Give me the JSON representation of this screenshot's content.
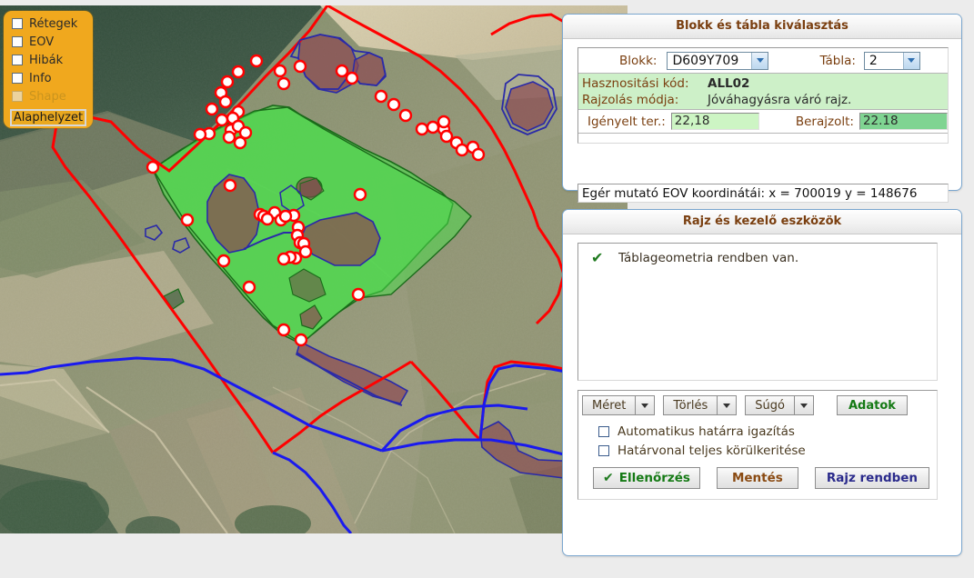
{
  "layers_panel": {
    "items": [
      {
        "label": "Rétegek",
        "checked": false,
        "enabled": true
      },
      {
        "label": "EOV",
        "checked": false,
        "enabled": true
      },
      {
        "label": "Hibák",
        "checked": false,
        "enabled": true
      },
      {
        "label": "Info",
        "checked": false,
        "enabled": true
      },
      {
        "label": "Shape",
        "checked": false,
        "enabled": false
      }
    ],
    "reset_button": "Alaphelyzet",
    "background_color": "#f0a81e"
  },
  "block_panel": {
    "title": "Blokk és tábla kiválasztás",
    "blokk_label": "Blokk:",
    "blokk_value": "D609Y709",
    "tabla_label": "Tábla:",
    "tabla_value": "2",
    "hasznositasi_kod_label": "Hasznositási kód:",
    "hasznositasi_kod_value": "ALL02",
    "rajzolas_modja_label": "Rajzolás módja:",
    "rajzolas_modja_value": "Jóváhagyásra váró rajz.",
    "igenyelt_label": "Igényelt ter.:",
    "igenyelt_value": "22,18",
    "berajzolt_label": "Berajzolt:",
    "berajzolt_value": "22.18",
    "coord_text": "Egér mutató EOV koordinátái: x = 700019   y = 148676",
    "info_bg_color": "#cdf0c8",
    "igenyelt_bg_color": "#cdf5c4",
    "berajzolt_bg_color": "#7fd492"
  },
  "tools_panel": {
    "title": "Rajz és kezelő eszközök",
    "message_icon": "check-icon",
    "message_text": "Táblageometria rendben van.",
    "buttons": {
      "meret": "Méret",
      "torles": "Törlés",
      "sugo": "Súgó",
      "adatok": "Adatok",
      "ellenorzes": "Ellenőrzés",
      "mentes": "Mentés",
      "rajz_rendben": "Rajz rendben"
    },
    "checkboxes": [
      {
        "label": "Automatikus határra igazítás",
        "checked": false
      },
      {
        "label": "Határvonal teljes körülkeritése",
        "checked": false
      }
    ]
  },
  "map": {
    "parcel_fill_color": "#4ddc4d",
    "parcel_outline_color": "#1a6b1a",
    "block_boundary_color": "#ff0000",
    "water_line_color": "#1a1aee",
    "excluded_area_color": "#8b4a52",
    "vertex_color": "#ffffff",
    "vertex_outline_color": "#ff0000"
  }
}
